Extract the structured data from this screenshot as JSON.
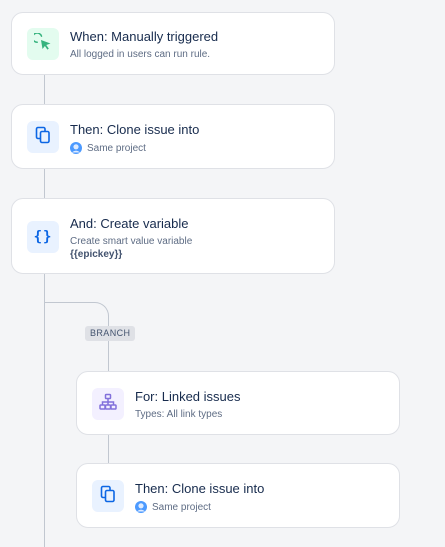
{
  "rule_steps": [
    {
      "title": "When: Manually triggered",
      "subtitle": "All logged in users can run rule.",
      "icon": "cursor-click-icon",
      "color": "#36b37e"
    },
    {
      "title": "Then: Clone issue into",
      "subtitle": "Same project",
      "icon": "copy-icon",
      "color": "#0c66e4"
    },
    {
      "title": "And: Create variable",
      "subtitle": "Create smart value variable",
      "detail": "{{epickey}}",
      "icon": "braces-icon",
      "color": "#0c66e4"
    }
  ],
  "branch": {
    "label": "BRANCH",
    "steps": [
      {
        "title": "For: Linked issues",
        "subtitle": "Types: All link types",
        "icon": "hierarchy-icon",
        "color": "#8270db"
      },
      {
        "title": "Then: Clone issue into",
        "subtitle": "Same project",
        "icon": "copy-icon",
        "color": "#0c66e4"
      }
    ]
  }
}
